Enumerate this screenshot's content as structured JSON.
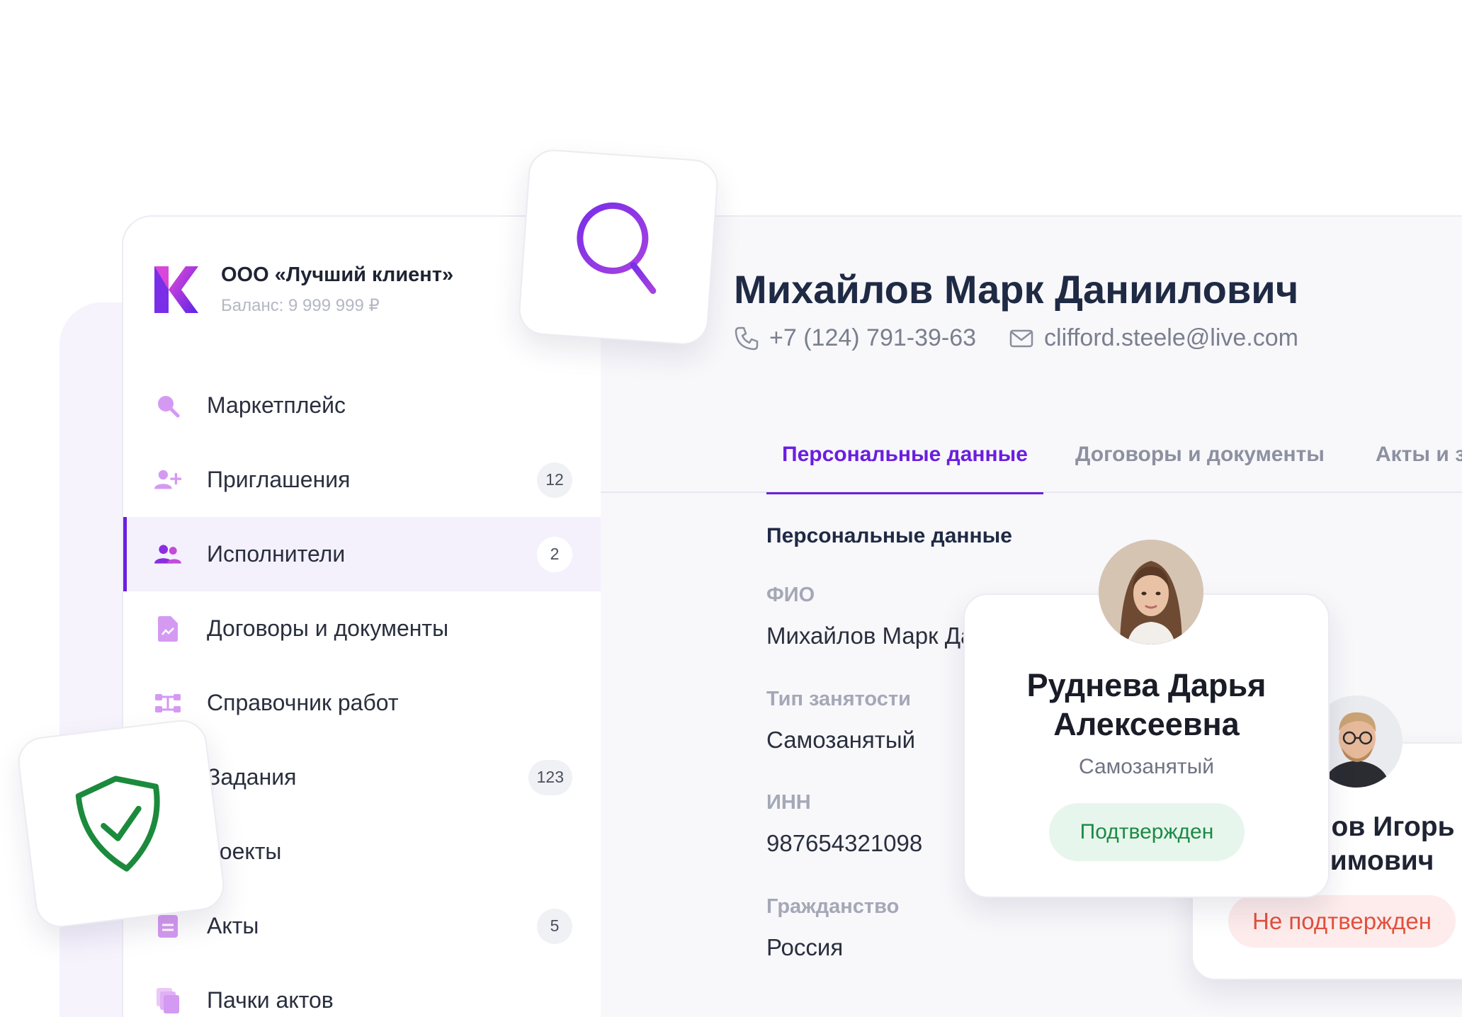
{
  "company": {
    "name": "ООО «Лучший клиент»",
    "balance": "Баланс: 9 999 999 ₽"
  },
  "sidebar": {
    "items": [
      {
        "label": "Маркетплейс",
        "icon": "search-icon",
        "badge": ""
      },
      {
        "label": "Приглашения",
        "icon": "add-user-icon",
        "badge": "12"
      },
      {
        "label": "Исполнители",
        "icon": "users-icon",
        "badge": "2"
      },
      {
        "label": "Договоры и документы",
        "icon": "document-icon",
        "badge": ""
      },
      {
        "label": "Справочник работ",
        "icon": "workflow-icon",
        "badge": ""
      },
      {
        "label": "Задания",
        "icon": "tasks-icon",
        "badge": "123"
      },
      {
        "label": "роекты",
        "icon": "projects-icon",
        "badge": ""
      },
      {
        "label": "Акты",
        "icon": "acts-icon",
        "badge": "5"
      },
      {
        "label": "Пачки актов",
        "icon": "acts-bundle-icon",
        "badge": ""
      }
    ],
    "active_index": 2
  },
  "person": {
    "name": "Михайлов Марк Даниилович",
    "phone": "+7 (124) 791-39-63",
    "email": "clifford.steele@live.com"
  },
  "tabs": [
    {
      "label": "Персональные данные"
    },
    {
      "label": "Договоры и документы"
    },
    {
      "label": "Акты и задания"
    }
  ],
  "personal": {
    "section_title": "Персональные данные",
    "fields": [
      {
        "label": "ФИО",
        "value": "Михайлов Марк Даниилови"
      },
      {
        "label": "Тип занятости",
        "value": "Самозанятый"
      },
      {
        "label": "ИНН",
        "value": "987654321098"
      },
      {
        "label": "Гражданство",
        "value": "Россия"
      }
    ]
  },
  "card_front": {
    "name_line1": "Руднева Дарья",
    "name_line2": "Алексеевна",
    "employment": "Самозанятый",
    "status": "Подтвержден"
  },
  "card_back": {
    "name_line1": "нов Игорь",
    "name_line2": "симович",
    "status": "Не подтвержден"
  },
  "colors": {
    "accent": "#6b1ee0",
    "icon_soft": "#d49af2",
    "confirmed": "#1c8a45",
    "not_confirmed": "#e2503e",
    "shield": "#1b8a3c"
  }
}
